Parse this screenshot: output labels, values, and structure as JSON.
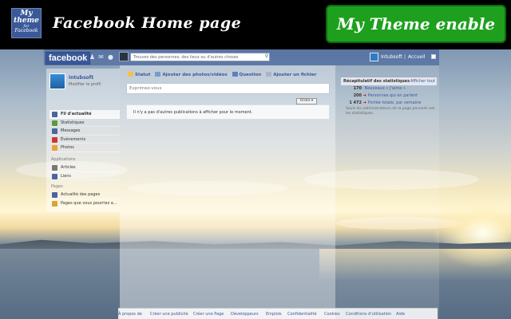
{
  "promo": {
    "logo_lines": [
      "My",
      "theme",
      "for",
      "Facebook"
    ],
    "title": "Facebook Home page",
    "badge": "My Theme enable"
  },
  "fb_bar": {
    "logo": "facebook",
    "search_placeholder": "Trouvez des personnes, des lieux ou d'autres choses",
    "user_name": "Intubsoft",
    "separator": "|",
    "home": "Accueil"
  },
  "profile": {
    "name": "Intubsoft",
    "edit": "Modifier le profil"
  },
  "nav": {
    "main": [
      {
        "label": "Fil d'actualité",
        "color": "#4a66a0",
        "active": true
      },
      {
        "label": "Statistiques",
        "color": "#5d9b3d",
        "active": false
      },
      {
        "label": "Messages",
        "color": "#4a66a0",
        "active": false
      },
      {
        "label": "Événements",
        "color": "#c8382f",
        "active": false
      },
      {
        "label": "Photos",
        "color": "#e6a23c",
        "active": false
      }
    ],
    "apps_heading": "Applications",
    "apps": [
      {
        "label": "Articles",
        "color": "#777"
      },
      {
        "label": "Liens",
        "color": "#4a66a0"
      }
    ],
    "pages_heading": "Pages",
    "pages": [
      {
        "label": "Actualité des pages",
        "color": "#4a66a0"
      },
      {
        "label": "Pages que vous pourriez a...",
        "color": "#d9a43a"
      }
    ]
  },
  "composer": {
    "actions": [
      "Statut",
      "Ajouter des photos/vidéos",
      "Question",
      "Ajouter un fichier"
    ],
    "placeholder": "Exprimez-vous",
    "order": "Ordre ▾",
    "empty_feed": "Il n'y a pas d'autres publications à afficher pour le moment."
  },
  "stats": {
    "title": "Récapitulatif des statistiques",
    "see_all": "Afficher tout",
    "rows": [
      {
        "value": "170",
        "label": "Nouveaux « J'aime »",
        "arrow": ""
      },
      {
        "value": "200",
        "label": "Personnes qui en parlent",
        "arrow": "➜"
      },
      {
        "value": "1 472",
        "label": "Portée totale, par semaine",
        "arrow": "➜"
      }
    ],
    "note": "Seuls les administrateurs de la page peuvent voir les statistiques."
  },
  "footer": {
    "links": [
      "À propos de",
      "Créer une publicité",
      "Créer une Page",
      "Développeurs",
      "Emplois",
      "Confidentialité",
      "Cookies",
      "Conditions d'utilisation",
      "Aide"
    ]
  }
}
